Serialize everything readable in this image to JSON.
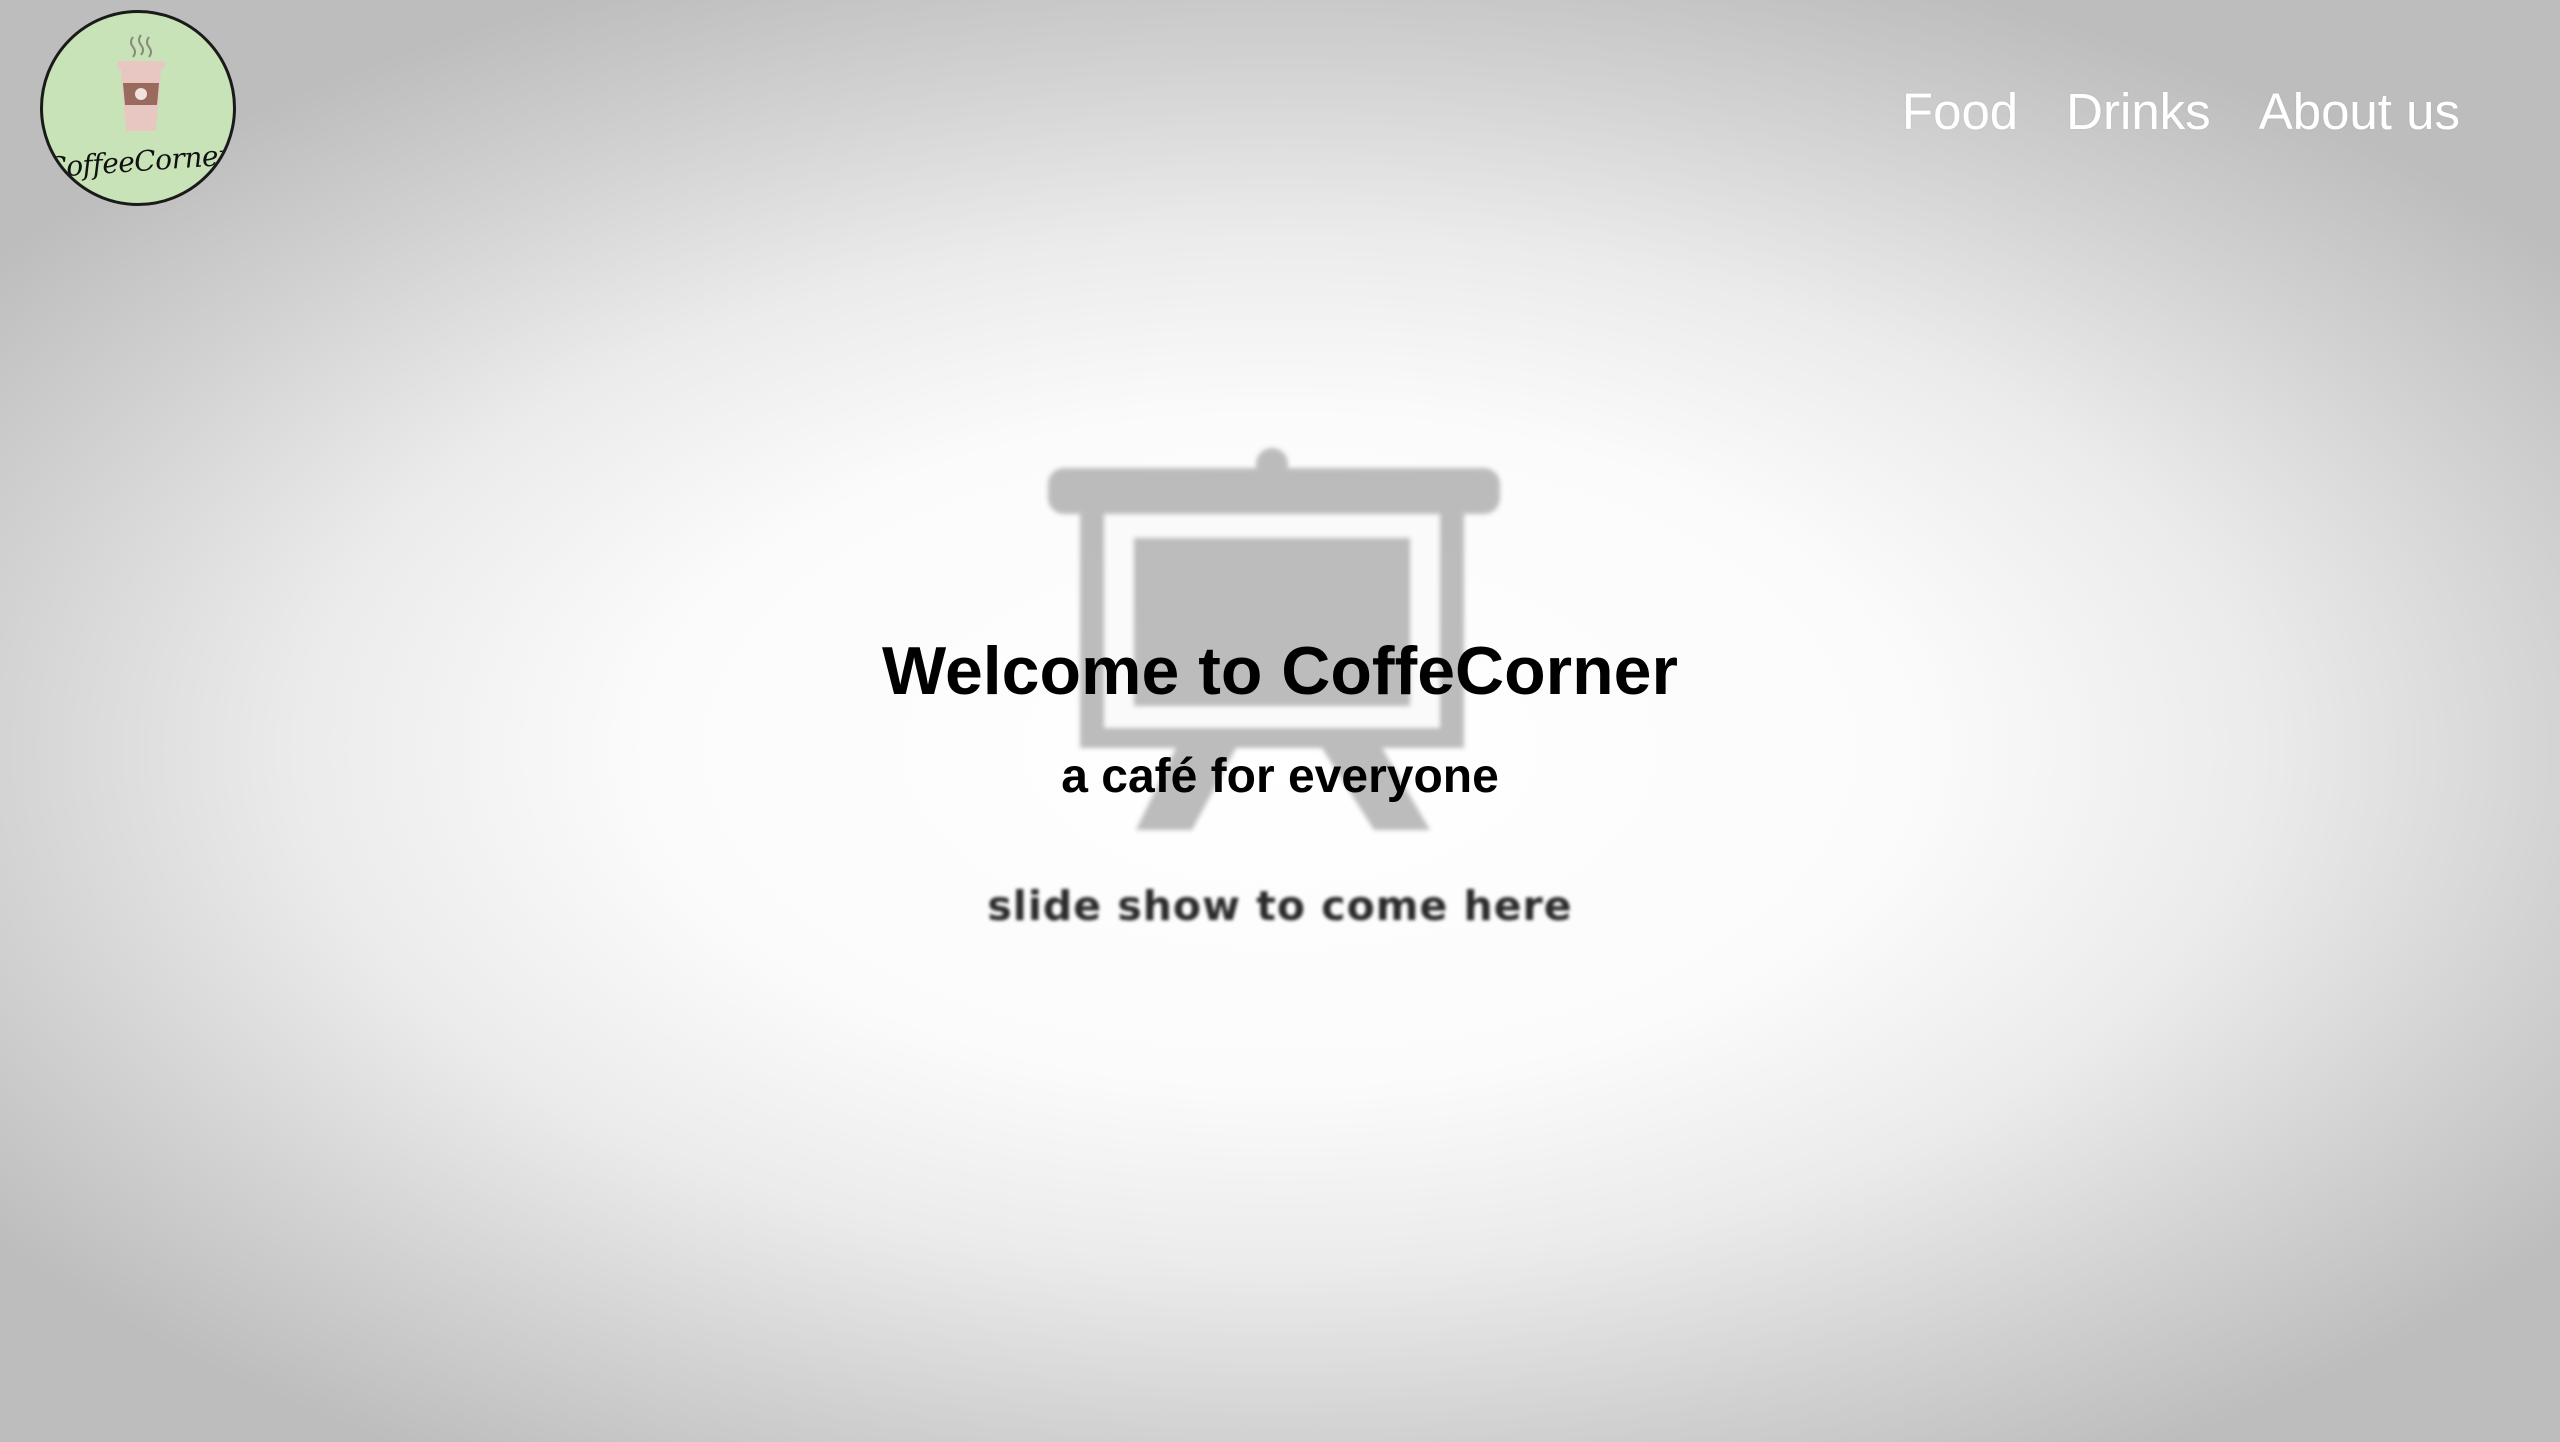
{
  "logo": {
    "text": "CoffeeCorner",
    "icon": "coffee-cup-icon"
  },
  "nav": {
    "items": [
      {
        "label": "Food"
      },
      {
        "label": "Drinks"
      },
      {
        "label": "About us"
      }
    ]
  },
  "hero": {
    "title": "Welcome to CoffeCorner",
    "subtitle": "a café for everyone",
    "placeholder": "slide show to come here",
    "background_icon": "projector-screen-icon"
  },
  "colors": {
    "logo_background": "#c8e3b7",
    "cup": "#e8c7c3",
    "cup_band": "#9a6a5e",
    "nav_text": "#ffffff",
    "icon_gray": "#b5b5b5"
  }
}
